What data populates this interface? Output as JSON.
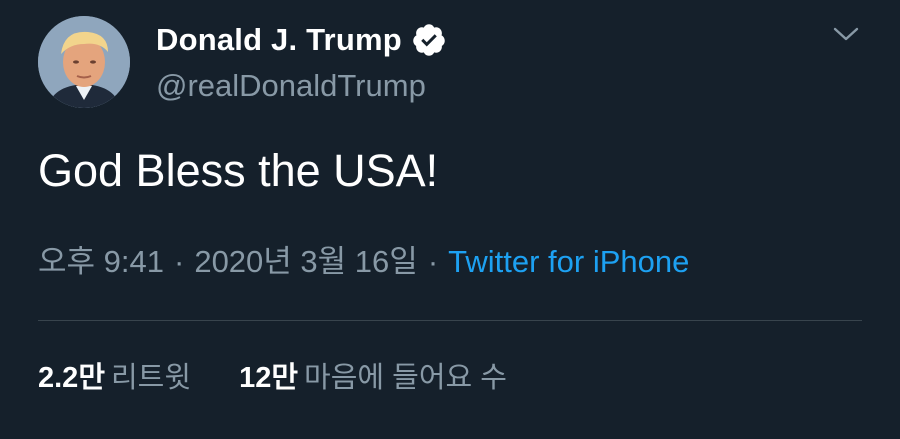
{
  "tweet": {
    "author": {
      "display_name": "Donald J. Trump",
      "handle": "@realDonaldTrump",
      "verified": true
    },
    "text": "God Bless the USA!",
    "time": "오후 9:41",
    "separator": "·",
    "date": "2020년 3월 16일",
    "source": "Twitter for iPhone",
    "stats": [
      {
        "count": "2.2만",
        "label": "리트윗"
      },
      {
        "count": "12만",
        "label": "마음에 들어요 수"
      }
    ]
  },
  "colors": {
    "background": "#15202b",
    "text_primary": "#ffffff",
    "text_secondary": "#8899a6",
    "link": "#1da1f2",
    "divider": "#38444d"
  },
  "icons": {
    "verified": "verified-badge-icon",
    "menu": "chevron-down-icon"
  }
}
